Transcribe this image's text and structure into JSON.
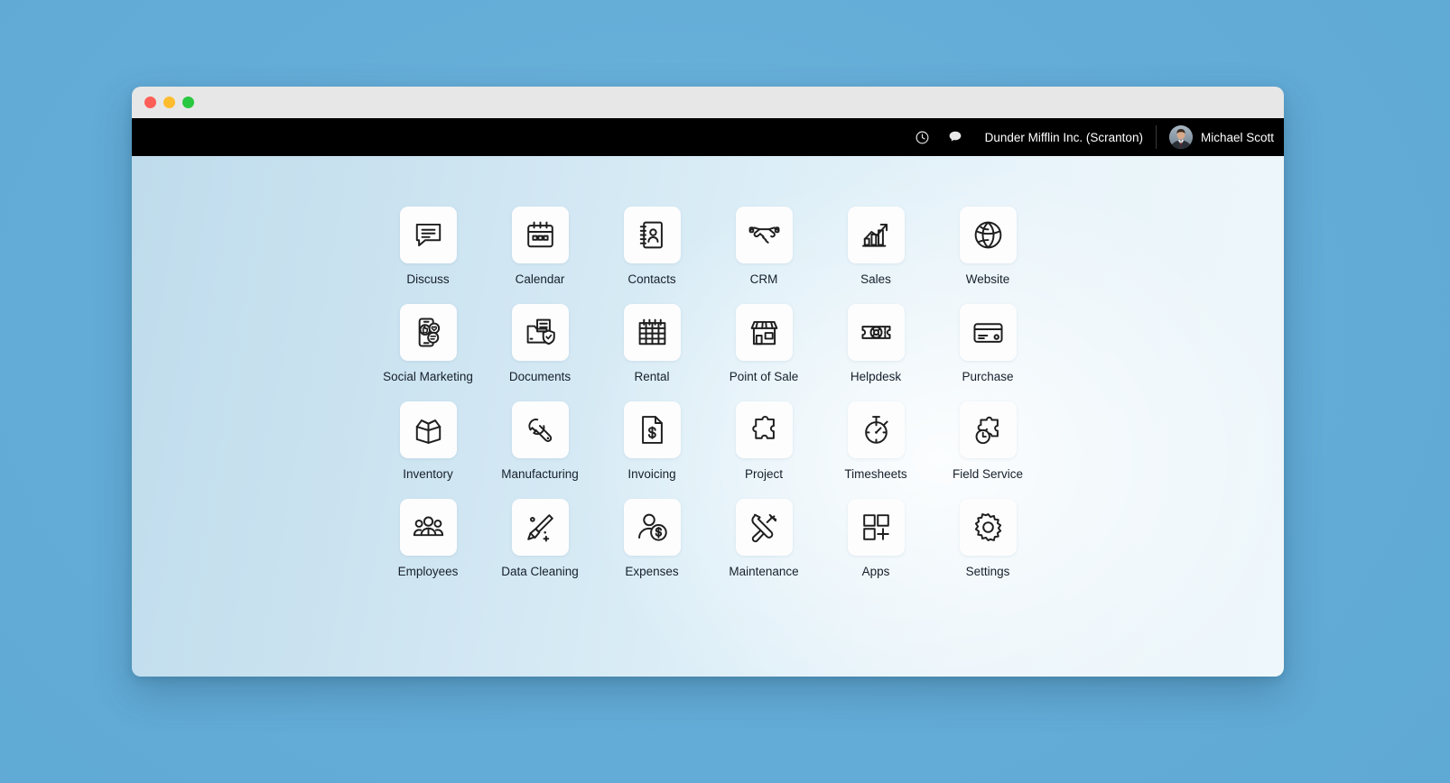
{
  "window": {
    "traffic_lights": [
      {
        "name": "close",
        "color": "#ff5f57"
      },
      {
        "name": "minimize",
        "color": "#febc2e"
      },
      {
        "name": "maximize",
        "color": "#28c840"
      }
    ]
  },
  "topnav": {
    "activity_icon": "clock-icon",
    "messages_icon": "chat-bubble-icon",
    "company": "Dunder Mifflin Inc. (Scranton)",
    "user_name": "Michael Scott",
    "avatar_icon": "user-avatar-photo",
    "background": "#000000",
    "text_color": "#ffffff"
  },
  "desktop": {
    "background_start": "#bfdcec",
    "background_end": "#eef7fb",
    "apps": [
      {
        "label": "Discuss",
        "icon": "discuss-icon"
      },
      {
        "label": "Calendar",
        "icon": "calendar-icon"
      },
      {
        "label": "Contacts",
        "icon": "contacts-icon"
      },
      {
        "label": "CRM",
        "icon": "handshake-icon"
      },
      {
        "label": "Sales",
        "icon": "growth-chart-icon"
      },
      {
        "label": "Website",
        "icon": "globe-icon"
      },
      {
        "label": "Social Marketing",
        "icon": "social-phone-icon"
      },
      {
        "label": "Documents",
        "icon": "documents-shield-icon"
      },
      {
        "label": "Rental",
        "icon": "calendar-grid-icon"
      },
      {
        "label": "Point of Sale",
        "icon": "storefront-icon"
      },
      {
        "label": "Helpdesk",
        "icon": "lifebuoy-ticket-icon"
      },
      {
        "label": "Purchase",
        "icon": "credit-card-icon"
      },
      {
        "label": "Inventory",
        "icon": "open-box-icon"
      },
      {
        "label": "Manufacturing",
        "icon": "wrench-icon"
      },
      {
        "label": "Invoicing",
        "icon": "dollar-document-icon"
      },
      {
        "label": "Project",
        "icon": "puzzle-piece-icon"
      },
      {
        "label": "Timesheets",
        "icon": "stopwatch-icon"
      },
      {
        "label": "Field Service",
        "icon": "puzzle-clock-icon"
      },
      {
        "label": "Employees",
        "icon": "people-group-icon"
      },
      {
        "label": "Data Cleaning",
        "icon": "broom-sparkle-icon"
      },
      {
        "label": "Expenses",
        "icon": "person-dollar-icon"
      },
      {
        "label": "Maintenance",
        "icon": "hammer-wrench-icon"
      },
      {
        "label": "Apps",
        "icon": "apps-grid-plus-icon"
      },
      {
        "label": "Settings",
        "icon": "gear-icon"
      }
    ]
  }
}
